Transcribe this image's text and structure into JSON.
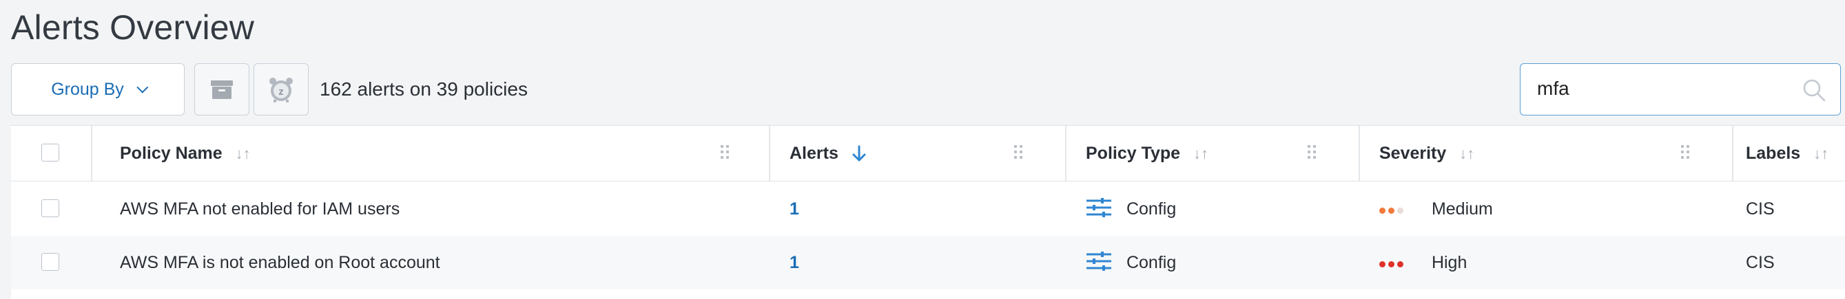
{
  "page": {
    "title": "Alerts Overview"
  },
  "toolbar": {
    "group_by_label": "Group By",
    "alerts_summary": "162 alerts on 39 policies",
    "search_value": "mfa"
  },
  "table": {
    "headers": {
      "policy_name": "Policy Name",
      "alerts": "Alerts",
      "policy_type": "Policy Type",
      "severity": "Severity",
      "labels": "Labels"
    },
    "rows": [
      {
        "policy_name": "AWS MFA not enabled for IAM users",
        "alerts": "1",
        "policy_type": "Config",
        "severity": "Medium",
        "severity_level": 2,
        "labels": "CIS"
      },
      {
        "policy_name": "AWS MFA is not enabled on Root account",
        "alerts": "1",
        "policy_type": "Config",
        "severity": "High",
        "severity_level": 3,
        "labels": "CIS"
      }
    ]
  },
  "colors": {
    "accent": "#1a6db5",
    "severity_medium": "#f07a3c",
    "severity_high": "#e0302a",
    "severity_inactive": "#e9dcd8"
  },
  "icons": {
    "group_by_chevron": "chevron-down-icon",
    "archive": "archive-icon",
    "snooze": "alarm-clock-icon",
    "search": "search-icon",
    "sort": "sort-icon",
    "sort_active": "arrow-down-icon",
    "column_grip": "drag-handle-icon",
    "policy_type": "sliders-icon"
  }
}
